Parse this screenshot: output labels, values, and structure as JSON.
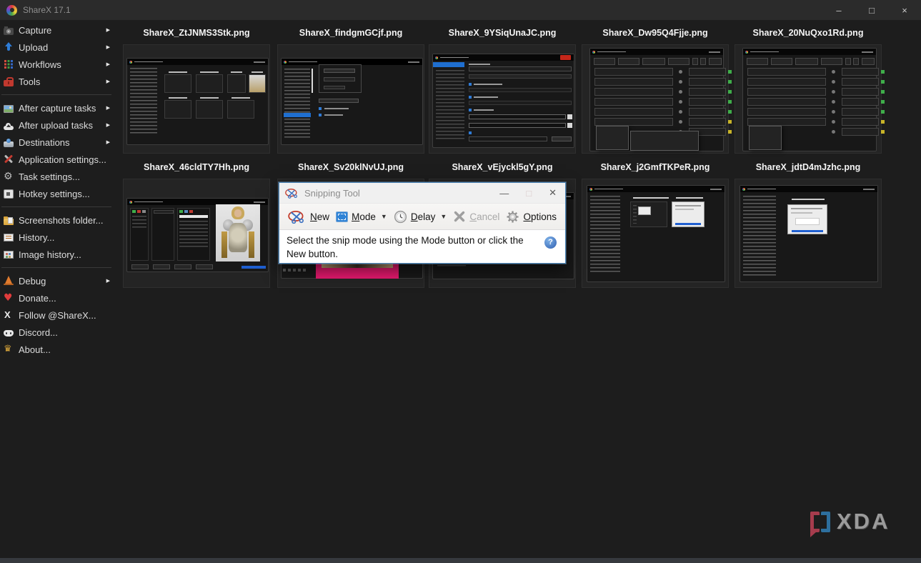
{
  "titlebar": {
    "app_title": "ShareX 17.1",
    "minimize": "–",
    "maximize": "□",
    "close": "×"
  },
  "sidebar": {
    "submenu_arrow": "▶",
    "items": [
      {
        "label": "Capture",
        "icon": "camera",
        "has_submenu": true
      },
      {
        "label": "Upload",
        "icon": "upload-arrow",
        "has_submenu": true
      },
      {
        "label": "Workflows",
        "icon": "workflow-grid",
        "has_submenu": true
      },
      {
        "label": "Tools",
        "icon": "toolbox",
        "has_submenu": true
      },
      {
        "label": "After capture tasks",
        "icon": "photo",
        "has_submenu": true
      },
      {
        "label": "After upload tasks",
        "icon": "cloud-upload",
        "has_submenu": true
      },
      {
        "label": "Destinations",
        "icon": "drive",
        "has_submenu": true
      },
      {
        "label": "Application settings...",
        "icon": "wrench-screwdriver",
        "has_submenu": false
      },
      {
        "label": "Task settings...",
        "icon": "gear",
        "has_submenu": false
      },
      {
        "label": "Hotkey settings...",
        "icon": "keyboard-key",
        "has_submenu": false
      },
      {
        "label": "Screenshots folder...",
        "icon": "folder",
        "has_submenu": false
      },
      {
        "label": "History...",
        "icon": "history-list",
        "has_submenu": false
      },
      {
        "label": "Image history...",
        "icon": "image-grid",
        "has_submenu": false
      },
      {
        "label": "Debug",
        "icon": "traffic-cone",
        "has_submenu": true
      },
      {
        "label": "Donate...",
        "icon": "heart",
        "has_submenu": false
      },
      {
        "label": "Follow @ShareX...",
        "icon": "x-logo",
        "has_submenu": false
      },
      {
        "label": "Discord...",
        "icon": "discord",
        "has_submenu": false
      },
      {
        "label": "About...",
        "icon": "crown",
        "has_submenu": false
      }
    ]
  },
  "gallery": {
    "items": [
      {
        "filename": "ShareX_ZtJNMS3Stk.png",
        "preview": "sharex-main-window-with-thumbnail-grid"
      },
      {
        "filename": "ShareX_findgmGCjf.png",
        "preview": "destination-settings-window"
      },
      {
        "filename": "ShareX_9YSiqUnaJC.png",
        "preview": "task-settings-capture-region-window"
      },
      {
        "filename": "ShareX_Dw95Q4Fjje.png",
        "preview": "hotkey-settings-window-with-upload-submenu"
      },
      {
        "filename": "ShareX_20NuQxo1Rd.png",
        "preview": "hotkey-settings-window-with-menu"
      },
      {
        "filename": "ShareX_46cldTY7Hh.png",
        "preview": "image-effects-window-knight-portrait"
      },
      {
        "filename": "ShareX_Sv20klNvUJ.png",
        "preview": "image-editor-pink-partially-covered-by-snipping-tool"
      },
      {
        "filename": "ShareX_vEjyckl5gY.png",
        "preview": "dark-window-mostly-covered-by-snipping-tool"
      },
      {
        "filename": "ShareX_j2GmfTKPeR.png",
        "preview": "sharex-main-window-two-thumbnails"
      },
      {
        "filename": "ShareX_jdtD4mJzhc.png",
        "preview": "sharex-main-window-one-thumbnail"
      }
    ]
  },
  "snipping_tool": {
    "title": "Snipping Tool",
    "minimize": "—",
    "maximize": "□",
    "close": "✕",
    "toolbar": {
      "new": "New",
      "mode": "Mode",
      "delay": "Delay",
      "cancel": "Cancel",
      "options": "Options",
      "dropdown_arrow": "▼"
    },
    "message": "Select the snip mode using the Mode button or click the New button.",
    "help": "?"
  },
  "watermark": {
    "text": "XDA"
  }
}
